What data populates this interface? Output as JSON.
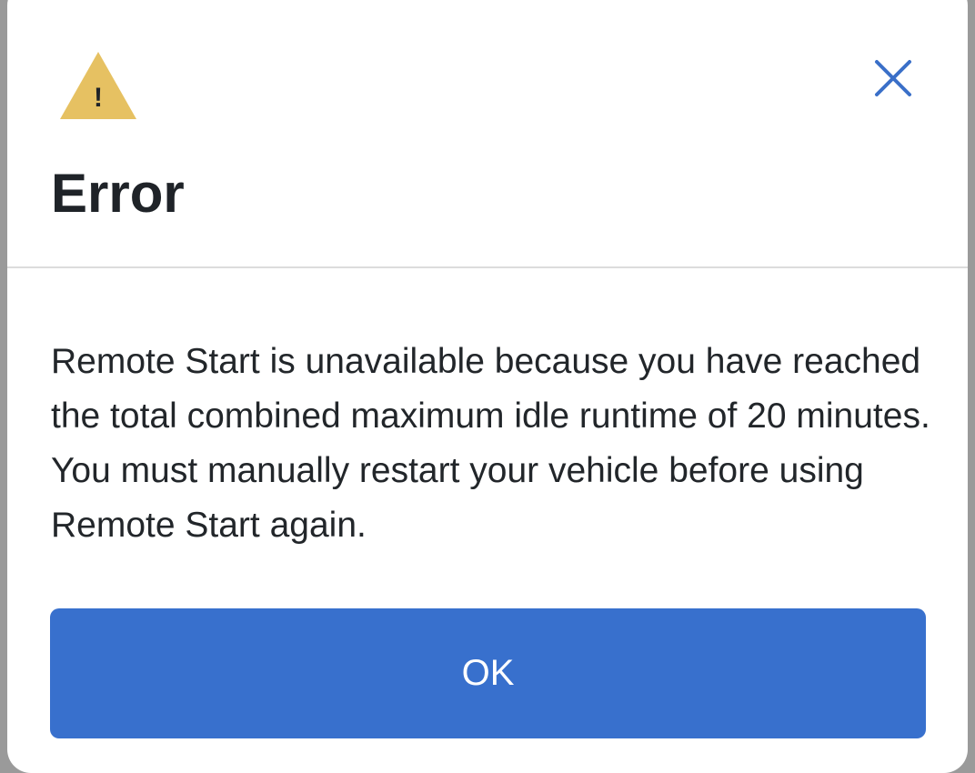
{
  "dialog": {
    "title": "Error",
    "message": "Remote Start is unavailable because you have reached the total combined maximum idle runtime of 20 minutes. You must manually restart your vehicle before using Remote Start again.",
    "ok_label": "OK"
  },
  "icons": {
    "warning": "warning-icon",
    "warning_glyph": "!",
    "close": "close-icon"
  },
  "colors": {
    "primary_button": "#3870cd",
    "warning": "#e6c162",
    "close_icon": "#3a6fc8",
    "title_text": "#1f2328",
    "backdrop": "#9a9a9a"
  }
}
